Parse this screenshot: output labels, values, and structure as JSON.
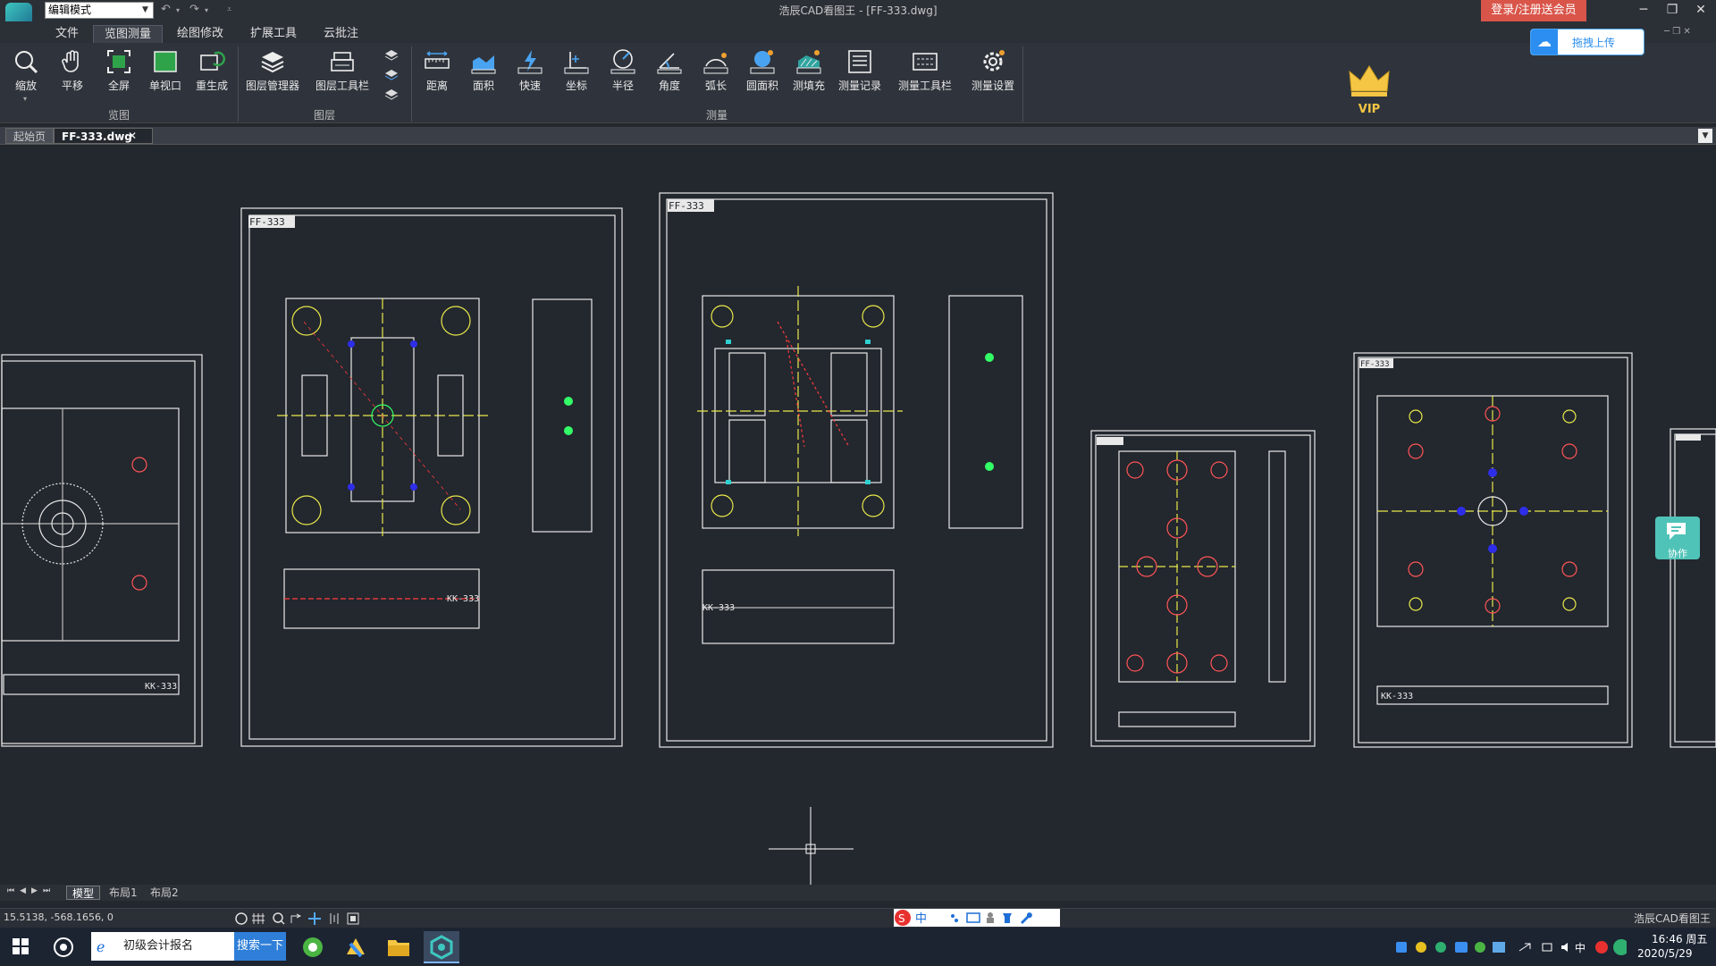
{
  "titlebar": {
    "mode": "编辑模式",
    "title": "浩辰CAD看图王 - [FF-333.dwg]",
    "login": "登录/注册送会员",
    "upload": "拖拽上传",
    "vip": "VIP"
  },
  "menu": [
    "文件",
    "览图测量",
    "绘图修改",
    "扩展工具",
    "云批注"
  ],
  "ribbon": {
    "view_tools": [
      "缩放",
      "平移",
      "全屏",
      "单视口",
      "重生成"
    ],
    "layer_tools": [
      "图层管理器",
      "图层工具栏"
    ],
    "measure_tools": [
      "距离",
      "面积",
      "快速",
      "坐标",
      "半径",
      "角度",
      "弧长",
      "圆面积",
      "测填充",
      "测量记录",
      "测量工具栏",
      "测量设置"
    ],
    "groups": [
      "览图",
      "图层",
      "测量"
    ]
  },
  "tabs": [
    "起始页",
    "FF-333.dwg"
  ],
  "drawing": {
    "sheet_label": "FF-333",
    "part_label": "KK-333",
    "sheet_label_short": "FF-333"
  },
  "layout_tabs": [
    "模型",
    "布局1",
    "布局2"
  ],
  "status": {
    "coords": "15.5138, -568.1656, 0",
    "app_name": "浩辰CAD看图王"
  },
  "collab": "协作",
  "taskbar": {
    "search_text": "初级会计报名",
    "search_button": "搜索一下",
    "time": "16:46 周五",
    "date": "2020/5/29"
  },
  "colors": {
    "canvas": "#23272e",
    "accent_red": "#d9554a",
    "accent_blue": "#2b8ef0",
    "line_white": "#e8e8e8",
    "line_red": "#ff3b3b",
    "line_yellow": "#e8e84a",
    "line_green": "#33ff66"
  }
}
